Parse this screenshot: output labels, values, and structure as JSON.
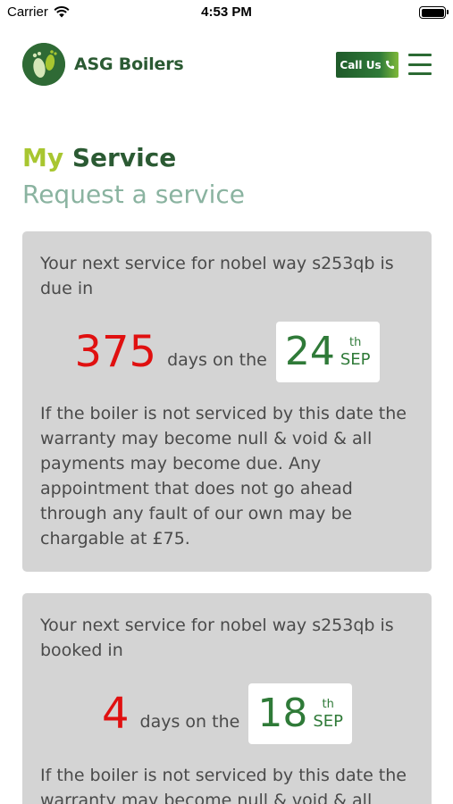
{
  "status_bar": {
    "carrier": "Carrier",
    "time": "4:53 PM"
  },
  "header": {
    "brand": "ASG Boilers",
    "call_label": "Call Us",
    "colors": {
      "brand_dark": "#2b5a33",
      "brand_light": "#a8c630"
    }
  },
  "page": {
    "title_part1": "My",
    "title_part2": "Service",
    "request_link": "Request a service"
  },
  "cards": [
    {
      "intro": "Your next service for nobel way s253qb is due in",
      "days": "375",
      "days_text": "days on the",
      "day": "24",
      "suffix": "th",
      "month": "SEP",
      "warning": "If the boiler is not serviced by this date the warranty may become null & void & all payments may become due. Any appointment that does not go ahead through any fault of our own may be chargable at £75."
    },
    {
      "intro": "Your next service for nobel way s253qb is booked in",
      "days": "4",
      "days_text": "days on the",
      "day": "18",
      "suffix": "th",
      "month": "SEP",
      "warning": "If the boiler is not serviced by this date the warranty may become null & void & all"
    }
  ]
}
